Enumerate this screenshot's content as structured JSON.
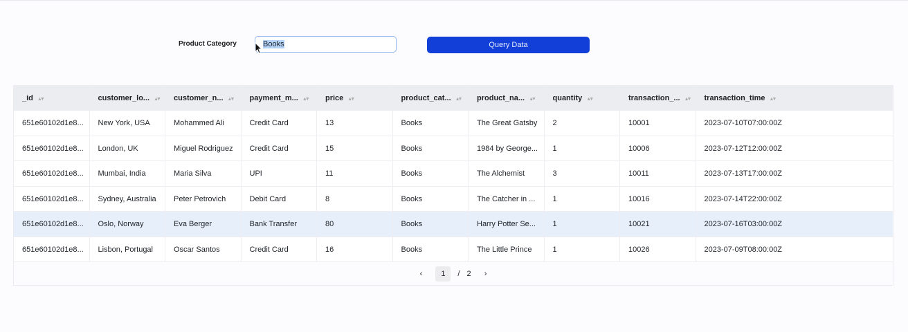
{
  "filter": {
    "label": "Product Category",
    "value": "Books"
  },
  "query_button": "Query Data",
  "columns": [
    "_id",
    "customer_lo...",
    "customer_n...",
    "payment_m...",
    "price",
    "product_cat...",
    "product_na...",
    "quantity",
    "transaction_...",
    "transaction_time"
  ],
  "rows": [
    [
      "651e60102d1e8...",
      "New York, USA",
      "Mohammed Ali",
      "Credit Card",
      "13",
      "Books",
      "The Great Gatsby",
      "2",
      "10001",
      "2023-07-10T07:00:00Z"
    ],
    [
      "651e60102d1e8...",
      "London, UK",
      "Miguel Rodriguez",
      "Credit Card",
      "15",
      "Books",
      "1984 by George...",
      "1",
      "10006",
      "2023-07-12T12:00:00Z"
    ],
    [
      "651e60102d1e8...",
      "Mumbai, India",
      "Maria Silva",
      "UPI",
      "11",
      "Books",
      "The Alchemist",
      "3",
      "10011",
      "2023-07-13T17:00:00Z"
    ],
    [
      "651e60102d1e8...",
      "Sydney, Australia",
      "Peter Petrovich",
      "Debit Card",
      "8",
      "Books",
      "The Catcher in ...",
      "1",
      "10016",
      "2023-07-14T22:00:00Z"
    ],
    [
      "651e60102d1e8...",
      "Oslo, Norway",
      "Eva Berger",
      "Bank Transfer",
      "80",
      "Books",
      "Harry Potter Se...",
      "1",
      "10021",
      "2023-07-16T03:00:00Z"
    ],
    [
      "651e60102d1e8...",
      "Lisbon, Portugal",
      "Oscar Santos",
      "Credit Card",
      "16",
      "Books",
      "The Little Prince",
      "1",
      "10026",
      "2023-07-09T08:00:00Z"
    ]
  ],
  "highlighted_row": 4,
  "pagination": {
    "prev": "‹",
    "current": "1",
    "separator": "/",
    "total": "2",
    "next": "›"
  }
}
